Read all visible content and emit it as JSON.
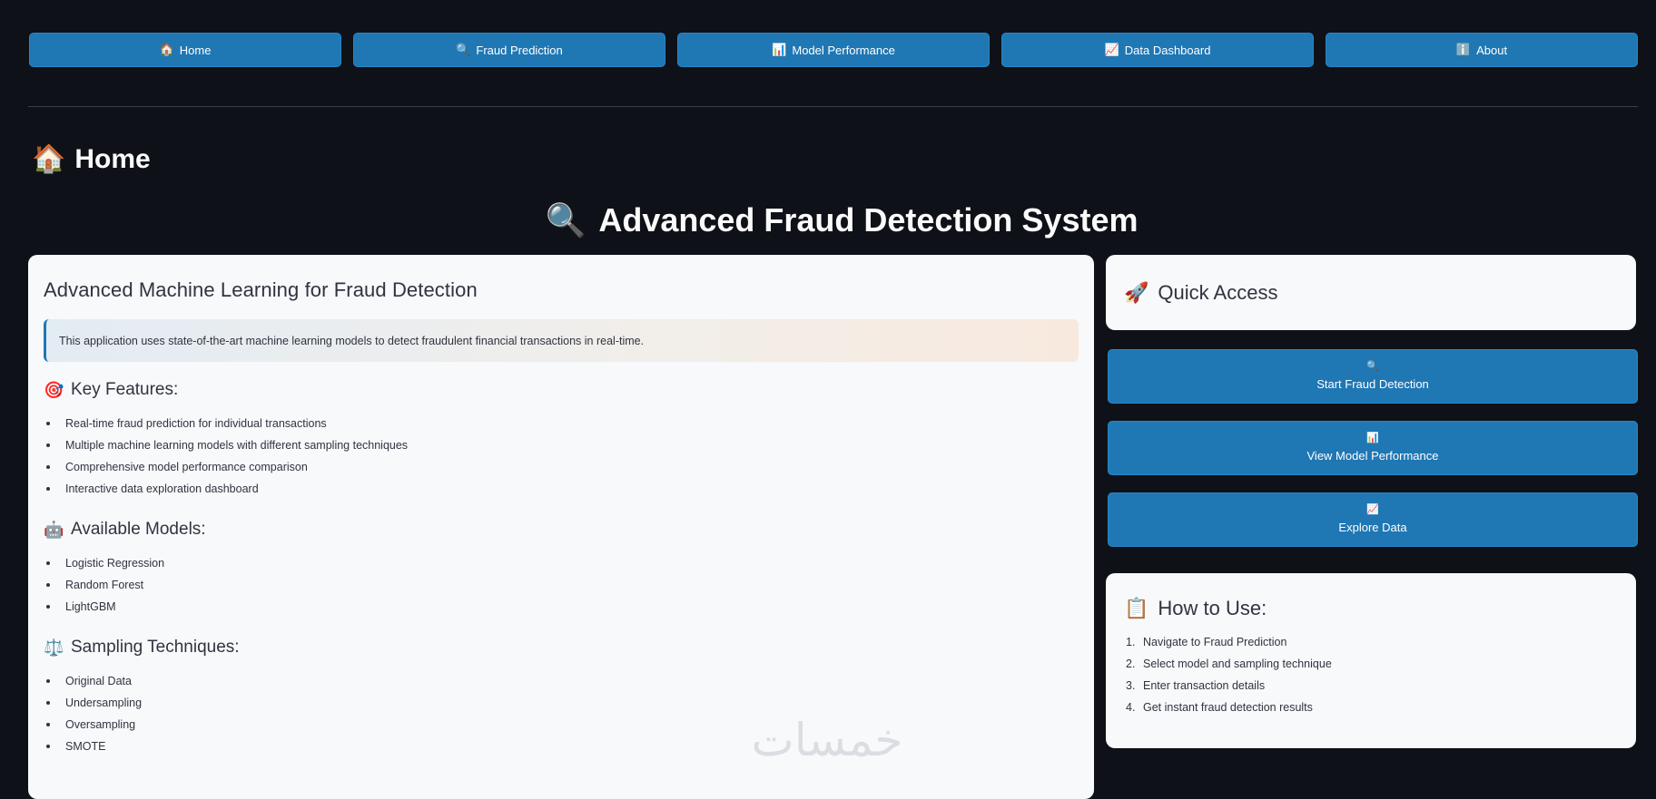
{
  "nav": [
    {
      "icon": "🏠",
      "label": "Home"
    },
    {
      "icon": "🔍",
      "label": "Fraud Prediction"
    },
    {
      "icon": "📊",
      "label": "Model Performance"
    },
    {
      "icon": "📈",
      "label": "Data Dashboard"
    },
    {
      "icon": "ℹ️",
      "label": "About"
    }
  ],
  "page": {
    "icon": "🏠",
    "title": "Home"
  },
  "hero": {
    "icon": "🔍",
    "title": "Advanced Fraud Detection System"
  },
  "intro": {
    "heading": "Advanced Machine Learning for Fraud Detection",
    "info": "This application uses state-of-the-art machine learning models to detect fraudulent financial transactions in real-time."
  },
  "features": {
    "icon": "🎯",
    "heading": "Key Features:",
    "items": [
      "Real-time fraud prediction for individual transactions",
      "Multiple machine learning models with different sampling techniques",
      "Comprehensive model performance comparison",
      "Interactive data exploration dashboard"
    ]
  },
  "models": {
    "icon": "🤖",
    "heading": "Available Models:",
    "items": [
      "Logistic Regression",
      "Random Forest",
      "LightGBM"
    ]
  },
  "sampling": {
    "icon": "⚖️",
    "heading": "Sampling Techniques:",
    "items": [
      "Original Data",
      "Undersampling",
      "Oversampling",
      "SMOTE"
    ]
  },
  "quick_access": {
    "icon": "🚀",
    "heading": "Quick Access",
    "buttons": [
      {
        "icon": "🔍",
        "label": "Start Fraud Detection"
      },
      {
        "icon": "📊",
        "label": "View Model Performance"
      },
      {
        "icon": "📈",
        "label": "Explore Data"
      }
    ]
  },
  "how_to": {
    "icon": "📋",
    "heading": "How to Use:",
    "steps": [
      {
        "num": "1.",
        "text": "Navigate to Fraud Prediction"
      },
      {
        "num": "2.",
        "text": "Select model and sampling technique"
      },
      {
        "num": "3.",
        "text": "Enter transaction details"
      },
      {
        "num": "4.",
        "text": "Get instant fraud detection results"
      }
    ]
  },
  "watermark": {
    "text": "خمسات"
  }
}
